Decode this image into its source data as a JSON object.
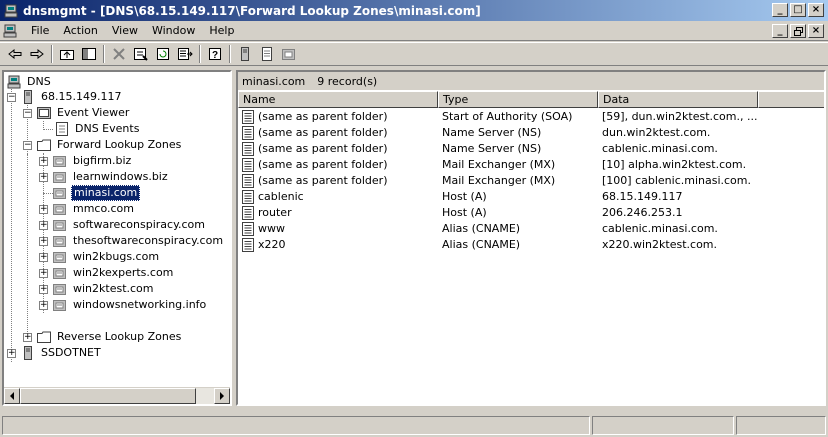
{
  "window": {
    "title": "dnsmgmt - [DNS\\68.15.149.117\\Forward Lookup Zones\\minasi.com]",
    "minimize_glyph": "_",
    "maximize_glyph": "□",
    "close_glyph": "×",
    "restore_glyph": "🗗"
  },
  "menu": {
    "file": "File",
    "action": "Action",
    "view": "View",
    "window": "Window",
    "help": "Help"
  },
  "tree": {
    "root": "DNS",
    "server": "68.15.149.117",
    "event_viewer": "Event Viewer",
    "dns_events": "DNS Events",
    "forward_zones": "Forward Lookup Zones",
    "zones": [
      "bigfirm.biz",
      "learnwindows.biz",
      "minasi.com",
      "mmco.com",
      "softwareconspiracy.com",
      "thesoftwareconspiracy.com",
      "win2kbugs.com",
      "win2kexperts.com",
      "win2ktest.com",
      "windowsnetworking.info"
    ],
    "reverse_zones": "Reverse Lookup Zones",
    "other_server": "SSDOTNET"
  },
  "details": {
    "zone_name": "minasi.com",
    "record_count": "9 record(s)",
    "columns": {
      "name": "Name",
      "type": "Type",
      "data": "Data"
    },
    "records": [
      {
        "name": "(same as parent folder)",
        "type": "Start of Authority (SOA)",
        "data": "[59], dun.win2ktest.com., ..."
      },
      {
        "name": "(same as parent folder)",
        "type": "Name Server (NS)",
        "data": "dun.win2ktest.com."
      },
      {
        "name": "(same as parent folder)",
        "type": "Name Server (NS)",
        "data": "cablenic.minasi.com."
      },
      {
        "name": "(same as parent folder)",
        "type": "Mail Exchanger (MX)",
        "data": "[10]  alpha.win2ktest.com."
      },
      {
        "name": "(same as parent folder)",
        "type": "Mail Exchanger (MX)",
        "data": "[100]  cablenic.minasi.com."
      },
      {
        "name": "cablenic",
        "type": "Host (A)",
        "data": "68.15.149.117"
      },
      {
        "name": "router",
        "type": "Host (A)",
        "data": "206.246.253.1"
      },
      {
        "name": "www",
        "type": "Alias (CNAME)",
        "data": "cablenic.minasi.com."
      },
      {
        "name": "x220",
        "type": "Alias (CNAME)",
        "data": "x220.win2ktest.com."
      }
    ]
  },
  "colors": {
    "titlebar_start": "#0a246a",
    "titlebar_end": "#a6caf0",
    "selection": "#0a246a",
    "chrome": "#d4d0c8"
  }
}
